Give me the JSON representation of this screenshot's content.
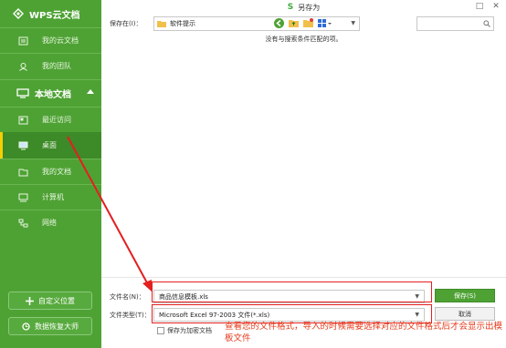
{
  "sidebar": {
    "brand": "WPS云文档",
    "items_cloud": [
      {
        "label": "我的云文档",
        "icon": "cloud-doc-icon"
      },
      {
        "label": "我的团队",
        "icon": "team-icon"
      }
    ],
    "local_section": {
      "label": "本地文档",
      "icon": "monitor-icon"
    },
    "items_local": [
      {
        "label": "最近访问",
        "icon": "recent-icon"
      },
      {
        "label": "桌面",
        "icon": "desktop-icon",
        "active": true
      },
      {
        "label": "我的文档",
        "icon": "my-docs-icon"
      },
      {
        "label": "计算机",
        "icon": "computer-icon"
      },
      {
        "label": "网络",
        "icon": "network-icon"
      }
    ],
    "custom_location_label": "自定义位置",
    "recovery_label": "数据恢复大师"
  },
  "dialog": {
    "title": "另存为",
    "save_in_label": "保存在(I)：",
    "save_in_value": "软件提示",
    "empty_message": "没有与搜索条件匹配的项。",
    "filename_label": "文件名(N)：",
    "filename_value": "商品信息模板.xls",
    "filetype_label": "文件类型(T)：",
    "filetype_value": "Microsoft Excel 97-2003 文件(*.xls)",
    "save_button": "保存(S)",
    "cancel_button": "取消",
    "encrypt_label": "保存为加密文档"
  },
  "annotation": {
    "text": "查看您的文件格式，导入的时候需要选择对应的文件格式后才会显示出模板文件"
  },
  "colors": {
    "sidebar_green": "#4ea234",
    "sidebar_active": "#3d8a28",
    "active_marker": "#f5d000",
    "annotation_red": "#e41f1f",
    "primary_button": "#4ea234"
  }
}
